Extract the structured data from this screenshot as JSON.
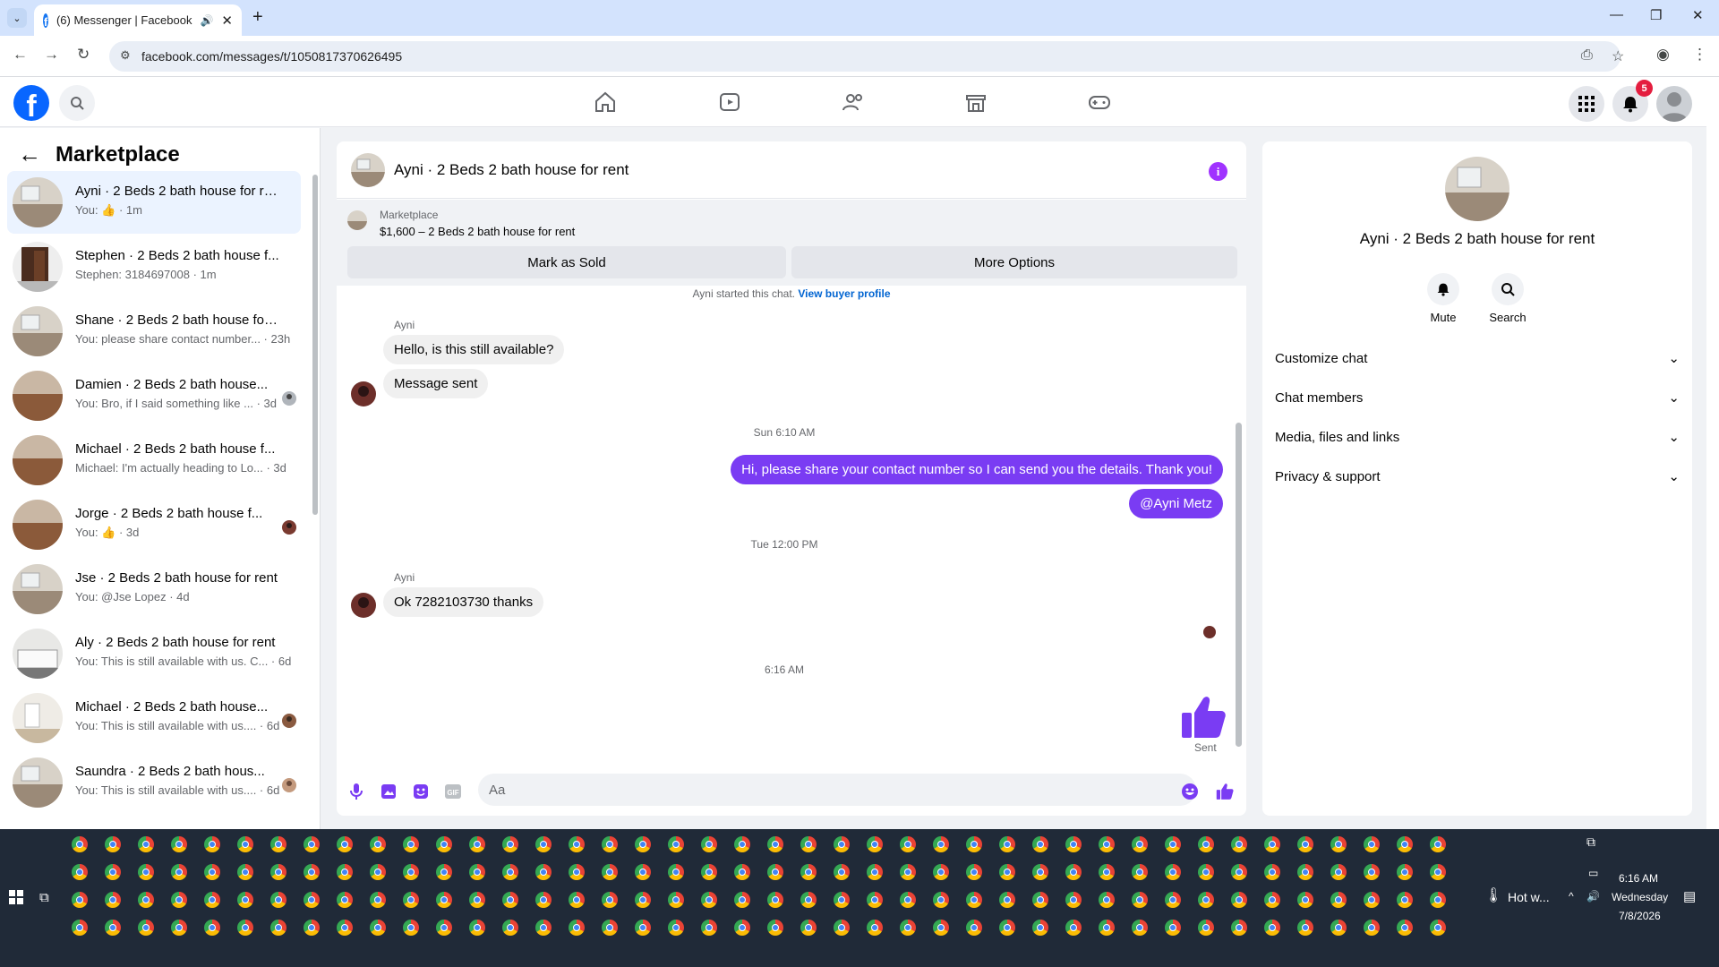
{
  "browser": {
    "tab_title": "(6) Messenger | Facebook",
    "url": "facebook.com/messages/t/1050817370626495"
  },
  "fb": {
    "notification_count": "5",
    "accent": "#0866ff"
  },
  "left": {
    "title": "Marketplace",
    "conversations": [
      {
        "name": "Ayni · 2 Beds 2 bath house for re...",
        "snippet": "You: 👍 · 1m",
        "active": true
      },
      {
        "name": "Stephen · 2 Beds 2 bath house f...",
        "snippet": "Stephen: 3184697008 · 1m"
      },
      {
        "name": "Shane · 2 Beds 2 bath house for ...",
        "snippet": "You: please share contact number... · 23h"
      },
      {
        "name": "Damien · 2 Beds 2 bath house...",
        "snippet": "You: Bro, if I said something like ... · 3d"
      },
      {
        "name": "Michael · 2 Beds 2 bath house f...",
        "snippet": "Michael: I'm actually heading to Lo... · 3d"
      },
      {
        "name": "Jorge · 2 Beds 2 bath house f...",
        "snippet": "You: 👍 · 3d"
      },
      {
        "name": "Jse · 2 Beds 2 bath house for rent",
        "snippet": "You: @Jse Lopez · 4d"
      },
      {
        "name": "Aly · 2 Beds 2 bath house for rent",
        "snippet": "You: This is still available with us. C... · 6d"
      },
      {
        "name": "Michael · 2 Beds 2 bath house...",
        "snippet": "You: This is still available with us.... · 6d"
      },
      {
        "name": "Saundra · 2 Beds 2 bath hous...",
        "snippet": "You: This is still available with us.... · 6d"
      }
    ]
  },
  "chat": {
    "title": "Ayni · 2 Beds 2 bath house for rent",
    "info_glyph": "i",
    "marketplace_label": "Marketplace",
    "listing": "$1,600 – 2 Beds 2 bath house for rent",
    "mark_sold": "Mark as Sold",
    "more_options": "More Options",
    "started_text": "Ayni started this chat.",
    "view_buyer": "View buyer profile",
    "sender1": "Ayni",
    "msg1": "Hello, is this still available?",
    "msg2": "Message sent",
    "ts1": "Sun 6:10 AM",
    "out1": "Hi, please share your contact number so I can send you the details. Thank you!",
    "out2": "@Ayni Metz",
    "ts2": "Tue 12:00 PM",
    "sender2": "Ayni",
    "msg3": "Ok 7282103730 thanks",
    "ts3": "6:16 AM",
    "sent_label": "Sent",
    "placeholder": "Aa",
    "bubble_color": "#7a3cf3"
  },
  "info": {
    "name": "Ayni · 2 Beds 2 bath house for rent",
    "mute": "Mute",
    "search": "Search",
    "sections": [
      "Customize chat",
      "Chat members",
      "Media, files and links",
      "Privacy & support"
    ]
  },
  "taskbar": {
    "weather": "Hot w...",
    "time": "6:16 AM",
    "day": "Wednesday",
    "date": "7/8/2026"
  }
}
